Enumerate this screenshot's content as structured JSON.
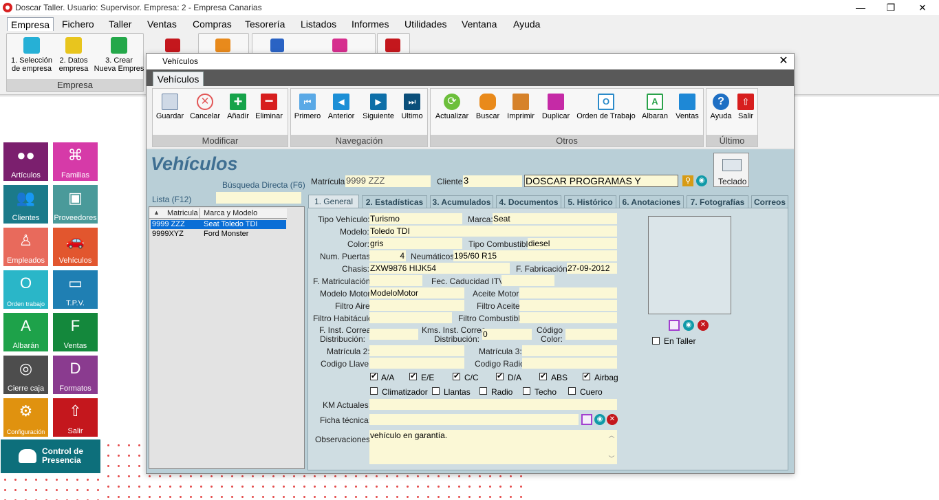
{
  "app": {
    "title": "Doscar Taller. Usuario: Supervisor. Empresa: 2 - Empresa Canarias",
    "window_buttons": [
      "—",
      "❐",
      "✕"
    ]
  },
  "menu": [
    "Empresa",
    "Fichero",
    "Taller",
    "Ventas",
    "Compras",
    "Tesorería",
    "Listados",
    "Informes",
    "Utilidades",
    "Ventana",
    "Ayuda"
  ],
  "ribbon": {
    "group_caption": "Empresa",
    "buttons": [
      {
        "l1": "1. Selección",
        "l2": "de empresa",
        "icon": "home-icon"
      },
      {
        "l1": "2. Datos",
        "l2": "empresa",
        "icon": "document-icon"
      },
      {
        "l1": "3. Crear",
        "l2": "Nueva Empres",
        "icon": "new-window-icon"
      }
    ]
  },
  "launcher": {
    "tiles": [
      {
        "label": "Artículos",
        "color": "#7b1f6e",
        "icon": "articles-icon"
      },
      {
        "label": "Familias",
        "color": "#d63aa8",
        "icon": "families-icon"
      },
      {
        "label": "Clientes",
        "color": "#1b7a8a",
        "icon": "clients-icon"
      },
      {
        "label": "Proveedores",
        "color": "#4a9a9a",
        "icon": "suppliers-icon"
      },
      {
        "label": "Empleados",
        "color": "#e86a5c",
        "icon": "employees-icon"
      },
      {
        "label": "Vehículos",
        "color": "#e2562e",
        "icon": "car-icon"
      },
      {
        "label": "Orden trabajo",
        "color": "#2ab6c8",
        "icon": "work-order-icon"
      },
      {
        "label": "T.P.V.",
        "color": "#1f7fb3",
        "icon": "pos-icon"
      },
      {
        "label": "Albarán",
        "color": "#1ea24a",
        "icon": "delivery-note-icon"
      },
      {
        "label": "Ventas",
        "color": "#14883c",
        "icon": "sales-icon"
      },
      {
        "label": "Cierre caja",
        "color": "#4d4d4d",
        "icon": "safe-icon"
      },
      {
        "label": "Formatos",
        "color": "#8a3b8f",
        "icon": "formats-icon"
      },
      {
        "label": "Configuración",
        "color": "#e0920f",
        "icon": "settings-icon"
      },
      {
        "label": "Salir",
        "color": "#c4171d",
        "icon": "exit-icon"
      }
    ],
    "presencia": "Control de Presencia"
  },
  "dialog": {
    "title": "Vehículos",
    "tab": "Vehículos",
    "heading": "Vehículos",
    "groups": [
      "Modificar",
      "Navegación",
      "Otros",
      "Último"
    ],
    "buttons": {
      "guardar": "Guardar",
      "cancelar": "Cancelar",
      "anadir": "Añadir",
      "eliminar": "Eliminar",
      "primero": "Primero",
      "anterior": "Anterior",
      "siguiente": "Siguiente",
      "ultimo": "Ultimo",
      "actualizar": "Actualizar",
      "buscar": "Buscar",
      "imprimir": "Imprimir",
      "duplicar": "Duplicar",
      "orden": "Orden de Trabajo",
      "albaran": "Albaran",
      "ventas": "Ventas",
      "ayuda": "Ayuda",
      "salir": "Salir"
    },
    "busqueda_label": "Búsqueda Directa (F6)",
    "lista_label": "Lista (F12)",
    "list": {
      "columns": [
        "Matricula",
        "Marca y Modelo"
      ],
      "rows": [
        {
          "matricula": "9999 ZZZ",
          "modelo": "Seat Toledo TDI"
        },
        {
          "matricula": "9999XYZ",
          "modelo": "Ford Monster"
        }
      ]
    },
    "header_fields": {
      "matricula_label": "Matrícula:",
      "matricula": "9999 ZZZ",
      "cliente_label": "Cliente:",
      "cliente": "3",
      "cliente_nombre": "DOSCAR PROGRAMAS Y",
      "teclado": "Teclado"
    },
    "tabs": [
      "1. General",
      "2. Estadísticas",
      "3. Acumulados",
      "4. Documentos",
      "5. Histórico",
      "6. Anotaciones",
      "7. Fotografías",
      "Correos"
    ],
    "form": {
      "tipo_vehiculo_label": "Tipo Vehículo:",
      "tipo_vehiculo": "Turismo",
      "marca_label": "Marca:",
      "marca": "Seat",
      "modelo_label": "Modelo:",
      "modelo": "Toledo TDI",
      "color_label": "Color:",
      "color": "gris",
      "tipo_combustible_label": "Tipo Combustible:",
      "tipo_combustible": "diesel",
      "num_puertas_label": "Num. Puertas:",
      "num_puertas": "4",
      "neumaticos_label": "Neumáticos:",
      "neumaticos": "195/60 R15",
      "chasis_label": "Chasis:",
      "chasis": "ZXW9876 HIJK54",
      "f_fabricacion_label": "F. Fabricación:",
      "f_fabricacion": "27-09-2012",
      "f_matriculacion_label": "F. Matriculación:",
      "fec_itv_label": "Fec. Caducidad ITV:",
      "modelo_motor_label": "Modelo Motor:",
      "modelo_motor": "ModeloMotor",
      "aceite_motor_label": "Aceite Motor:",
      "filtro_aire_label": "Filtro Aire:",
      "filtro_aceite_label": "Filtro Aceite:",
      "filtro_habitaculo_label": "Filtro Habitáculo:",
      "filtro_combustible_label": "Filtro Combustible:",
      "f_inst_correa_l1": "F. Inst. Correa",
      "f_inst_correa_l2": "Distribución:",
      "kms_inst_correa_l1": "Kms. Inst. Correa",
      "kms_inst_correa_l2": "Distribución:",
      "kms_inst_correa": "0",
      "codigo_color_l1": "Código",
      "codigo_color_l2": "Color:",
      "matricula2_label": "Matrícula 2:",
      "matricula3_label": "Matrícula 3:",
      "codigo_llave_label": "Codigo Llave:",
      "codigo_radio_label": "Codigo Radio:",
      "checks_row1": [
        {
          "label": "A/A",
          "checked": true
        },
        {
          "label": "E/E",
          "checked": true
        },
        {
          "label": "C/C",
          "checked": true
        },
        {
          "label": "D/A",
          "checked": true
        },
        {
          "label": "ABS",
          "checked": true
        },
        {
          "label": "Airbag",
          "checked": true
        }
      ],
      "checks_row2": [
        {
          "label": "Climatizador",
          "checked": false
        },
        {
          "label": "Llantas",
          "checked": false
        },
        {
          "label": "Radio",
          "checked": false
        },
        {
          "label": "Techo",
          "checked": false
        },
        {
          "label": "Cuero",
          "checked": false
        }
      ],
      "km_actuales_label": "KM Actuales:",
      "ficha_tecnica_label": "Ficha técnica:",
      "observaciones_label": "Observaciones:",
      "observaciones": "vehículo en garantía.",
      "en_taller": "En Taller"
    }
  }
}
